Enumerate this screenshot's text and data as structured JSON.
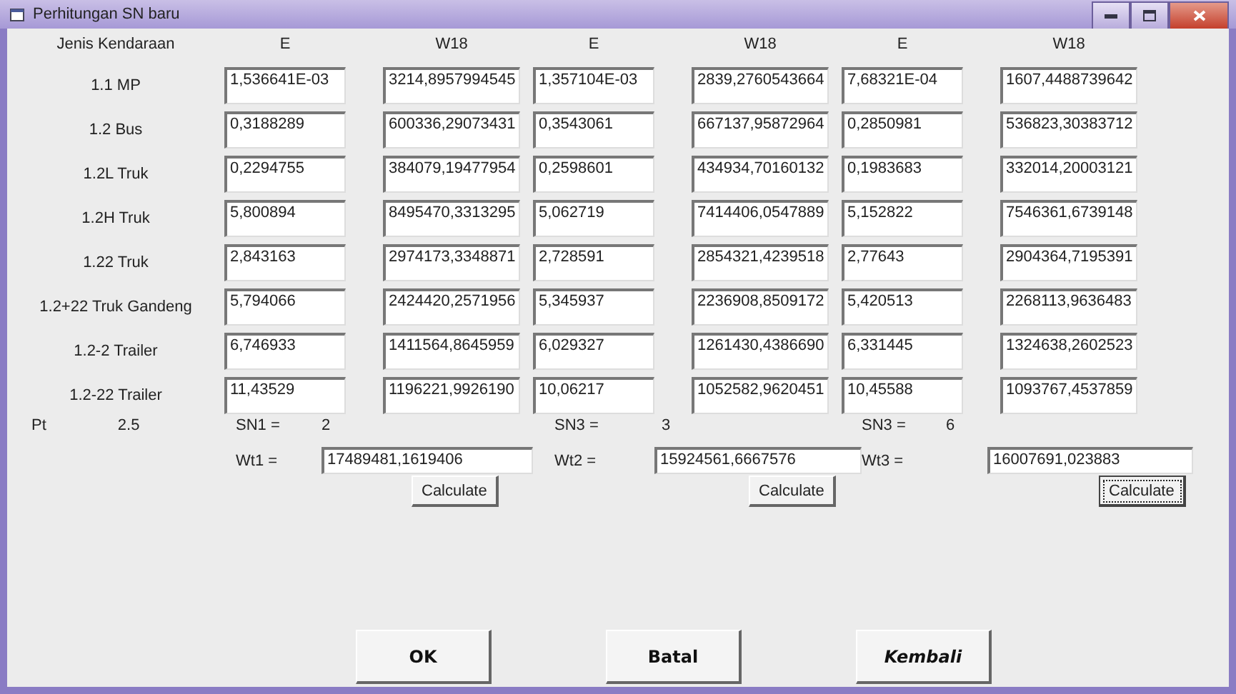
{
  "window": {
    "title": "Perhitungan SN baru"
  },
  "table": {
    "columns": [
      "Jenis Kendaraan",
      "E",
      "W18",
      "E",
      "W18",
      "E",
      "W18"
    ],
    "rows": [
      {
        "label": "1.1 MP",
        "values": [
          "1,536641E-03",
          "3214,8957994545",
          "1,357104E-03",
          "2839,2760543664",
          "7,68321E-04",
          "1607,4488739642"
        ]
      },
      {
        "label": "1.2 Bus",
        "values": [
          "0,3188289",
          "600336,29073431",
          "0,3543061",
          "667137,95872964",
          "0,2850981",
          "536823,30383712"
        ]
      },
      {
        "label": "1.2L Truk",
        "values": [
          "0,2294755",
          "384079,19477954",
          "0,2598601",
          "434934,70160132",
          "0,1983683",
          "332014,20003121"
        ]
      },
      {
        "label": "1.2H Truk",
        "values": [
          "5,800894",
          "8495470,3313295",
          "5,062719",
          "7414406,0547889",
          "5,152822",
          "7546361,6739148"
        ]
      },
      {
        "label": "1.22 Truk",
        "values": [
          "2,843163",
          "2974173,3348871",
          "2,728591",
          "2854321,4239518",
          "2,77643",
          "2904364,7195391"
        ]
      },
      {
        "label": "1.2+22 Truk Gandeng",
        "values": [
          "5,794066",
          "2424420,2571956",
          "5,345937",
          "2236908,8509172",
          "5,420513",
          "2268113,9636483"
        ]
      },
      {
        "label": "1.2-2 Trailer",
        "values": [
          "6,746933",
          "1411564,8645959",
          "6,029327",
          "1261430,4386690",
          "6,331445",
          "1324638,2602523"
        ]
      },
      {
        "label": "1.2-22 Trailer",
        "values": [
          "11,43529",
          "1196221,9926190",
          "10,06217",
          "1052582,9620451",
          "10,45588",
          "1093767,4537859"
        ]
      }
    ]
  },
  "pt": {
    "label": "Pt",
    "value": "2.5"
  },
  "groups": [
    {
      "sn_label": "SN1 =",
      "sn_value": "2",
      "wt_label": "Wt1 =",
      "wt_value": "17489481,1619406",
      "button": "Calculate",
      "focused": false
    },
    {
      "sn_label": "SN3 =",
      "sn_value": "3",
      "wt_label": "Wt2 =",
      "wt_value": "15924561,6667576",
      "button": "Calculate",
      "focused": false
    },
    {
      "sn_label": "SN3 =",
      "sn_value": "6",
      "wt_label": "Wt3 =",
      "wt_value": "16007691,023883",
      "button": "Calculate",
      "focused": true
    }
  ],
  "buttons": [
    {
      "label": "OK",
      "italic": false
    },
    {
      "label": "Batal",
      "italic": false
    },
    {
      "label": "Kembali",
      "italic": true
    }
  ]
}
